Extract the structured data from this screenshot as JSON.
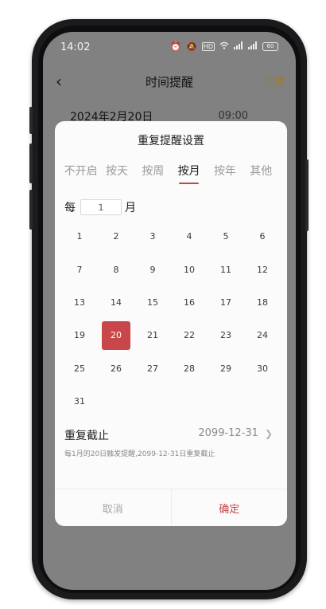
{
  "status_bar": {
    "time": "14:02",
    "icons": [
      "alarm-icon",
      "mute-icon",
      "hd-icon",
      "wifi-icon",
      "signal-icon",
      "signal-icon"
    ],
    "battery": "60"
  },
  "app_header": {
    "title": "时间提醒",
    "done_label": "完成"
  },
  "reminder_row": {
    "date": "2024年2月20日",
    "time": "09:00"
  },
  "dialog": {
    "title": "重复提醒设置",
    "tabs": [
      {
        "label": "不开启",
        "active": false
      },
      {
        "label": "按天",
        "active": false
      },
      {
        "label": "按周",
        "active": false
      },
      {
        "label": "按月",
        "active": true
      },
      {
        "label": "按年",
        "active": false
      },
      {
        "label": "其他",
        "active": false
      }
    ],
    "every_prefix": "每",
    "every_value": "1",
    "every_unit": "月",
    "days": [
      "1",
      "2",
      "3",
      "4",
      "5",
      "6",
      "7",
      "8",
      "9",
      "10",
      "11",
      "12",
      "13",
      "14",
      "15",
      "16",
      "17",
      "18",
      "19",
      "20",
      "21",
      "22",
      "23",
      "24",
      "25",
      "26",
      "27",
      "28",
      "29",
      "30",
      "31"
    ],
    "selected_day": "20",
    "repeat_until_label": "重复截止",
    "repeat_until_value": "2099-12-31",
    "summary": "每1月的20日触发提醒,2099-12-31日重复截止",
    "cancel_label": "取消",
    "confirm_label": "确定",
    "accent_color": "#c9474a"
  }
}
